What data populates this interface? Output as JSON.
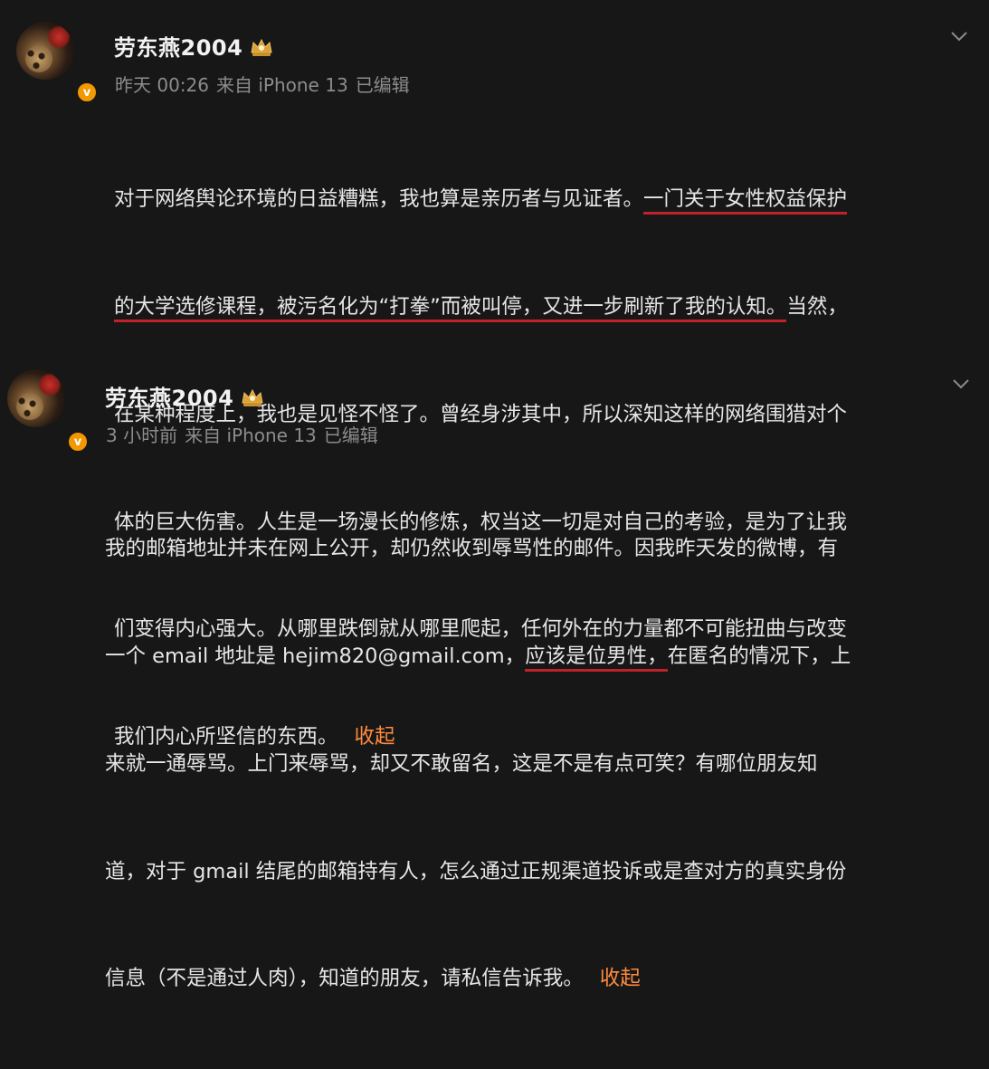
{
  "posts": [
    {
      "username": "劳东燕2004",
      "meta": {
        "time": "昨天 00:26",
        "source": "来自 iPhone 13",
        "edited": "已编辑"
      },
      "lines": [
        [
          "对于网络舆论环境的日益糟糕，我也算是亲历者与见证者。",
          "一门关于女性权益保护"
        ],
        [
          "的大学选修课程，被污名化为“打拳”而被叫停，又进一步刷新了我的认知。",
          "当然，"
        ],
        [
          "在某种程度上，我也是见怪不怪了。曾经身涉其中，所以深知这样的网络围猎对个"
        ],
        [
          "体的巨大伤害。人生是一场漫长的修炼，权当这一切是对自己的考验，是为了让我"
        ],
        [
          "们变得内心强大。从哪里跌倒就从哪里爬起，任何外在的力量都不可能扭曲与改变"
        ],
        [
          "我们内心所坚信的东西。"
        ]
      ],
      "collapse_label": "收起"
    },
    {
      "username": "劳东燕2004",
      "meta": {
        "time": "3 小时前",
        "source": "来自 iPhone 13",
        "edited": "已编辑"
      },
      "lines": [
        [
          "我的邮箱地址并未在网上公开，却仍然收到辱骂性的邮件。因我昨天发的微博，有"
        ],
        [
          "一个 email 地址是 hejim820@gmail.com，",
          "应该是位男性，",
          "在匿名的情况下，上"
        ],
        [
          "来就一通辱骂。上门来辱骂，却又不敢留名，这是不是有点可笑？有哪位朋友知"
        ],
        [
          "道，对于 gmail 结尾的邮箱持有人，怎么通过正规渠道投诉或是查对方的真实身份"
        ],
        [
          "信息（不是通过人肉），知道的朋友，请私信告诉我。"
        ]
      ],
      "collapse_label": "收起"
    }
  ],
  "colors": {
    "background": "#171717",
    "underline": "#c0212b",
    "collapse": "#ff8a3d",
    "verified_badge": "#f39800"
  },
  "icons": [
    "avatar",
    "verified-badge-icon",
    "crown-level-icon",
    "chevron-down-icon"
  ]
}
